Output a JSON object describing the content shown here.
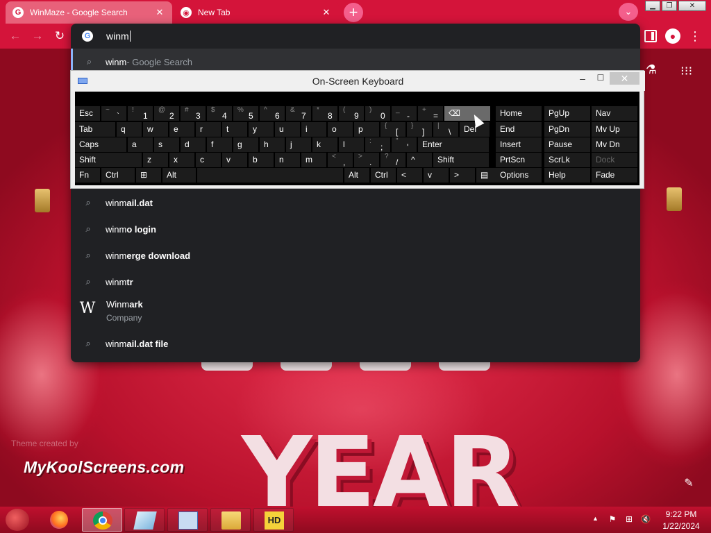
{
  "browser": {
    "tabs": [
      {
        "title": "WinMaze - Google Search",
        "icon": "google-icon"
      },
      {
        "title": "New Tab",
        "icon": "chrome-icon"
      }
    ],
    "accent_color": "#d4143a"
  },
  "omnibox": {
    "value": "winm",
    "suggestions": [
      {
        "typed": "winm",
        "rest": "",
        "suffix": " - Google Search",
        "icon": "search-icon"
      },
      {
        "typed": "winm",
        "rest": "ail.dat",
        "icon": "search-icon"
      },
      {
        "typed": "winm",
        "rest": "o login",
        "icon": "search-icon"
      },
      {
        "typed": "winm",
        "rest": "erge download",
        "icon": "search-icon"
      },
      {
        "typed": "winm",
        "rest": "tr",
        "icon": "search-icon"
      },
      {
        "typed": "Winm",
        "rest": "ark",
        "sub": "Company",
        "icon": "winmark-logo"
      },
      {
        "typed": "winm",
        "rest": "ail.dat file",
        "icon": "search-icon"
      }
    ]
  },
  "osk": {
    "title": "On-Screen Keyboard",
    "rows": [
      [
        "Esc",
        "~`",
        "!1",
        "@2",
        "#3",
        "$4",
        "%5",
        "^6",
        "&7",
        "*8",
        "(9",
        ")0",
        "_-",
        "+=",
        "⌫"
      ],
      [
        "Tab",
        "q",
        "w",
        "e",
        "r",
        "t",
        "y",
        "u",
        "i",
        "o",
        "p",
        "{[",
        "}]",
        "|\\",
        "Del"
      ],
      [
        "Caps",
        "a",
        "s",
        "d",
        "f",
        "g",
        "h",
        "j",
        "k",
        "l",
        ":;",
        "\"'",
        "Enter"
      ],
      [
        "Shift",
        "z",
        "x",
        "c",
        "v",
        "b",
        "n",
        "m",
        "<,",
        ">.",
        "?/",
        "^",
        "Shift"
      ],
      [
        "Fn",
        "Ctrl",
        "⊞",
        "Alt",
        "",
        "Alt",
        "Ctrl",
        "<",
        "v",
        ">",
        "▤"
      ]
    ],
    "nav_rows": [
      [
        "Home",
        "PgUp",
        "Nav"
      ],
      [
        "End",
        "PgDn",
        "Mv Up"
      ],
      [
        "Insert",
        "Pause",
        "Mv Dn"
      ],
      [
        "PrtScn",
        "ScrLk",
        "Dock"
      ],
      [
        "Options",
        "Help",
        "Fade"
      ]
    ]
  },
  "wallpaper": {
    "watermark": "MyKoolScreens.com",
    "theme_credit": "Theme created by",
    "year_text": "YEAR"
  },
  "taskbar": {
    "time": "9:22 PM",
    "date": "1/22/2024"
  }
}
